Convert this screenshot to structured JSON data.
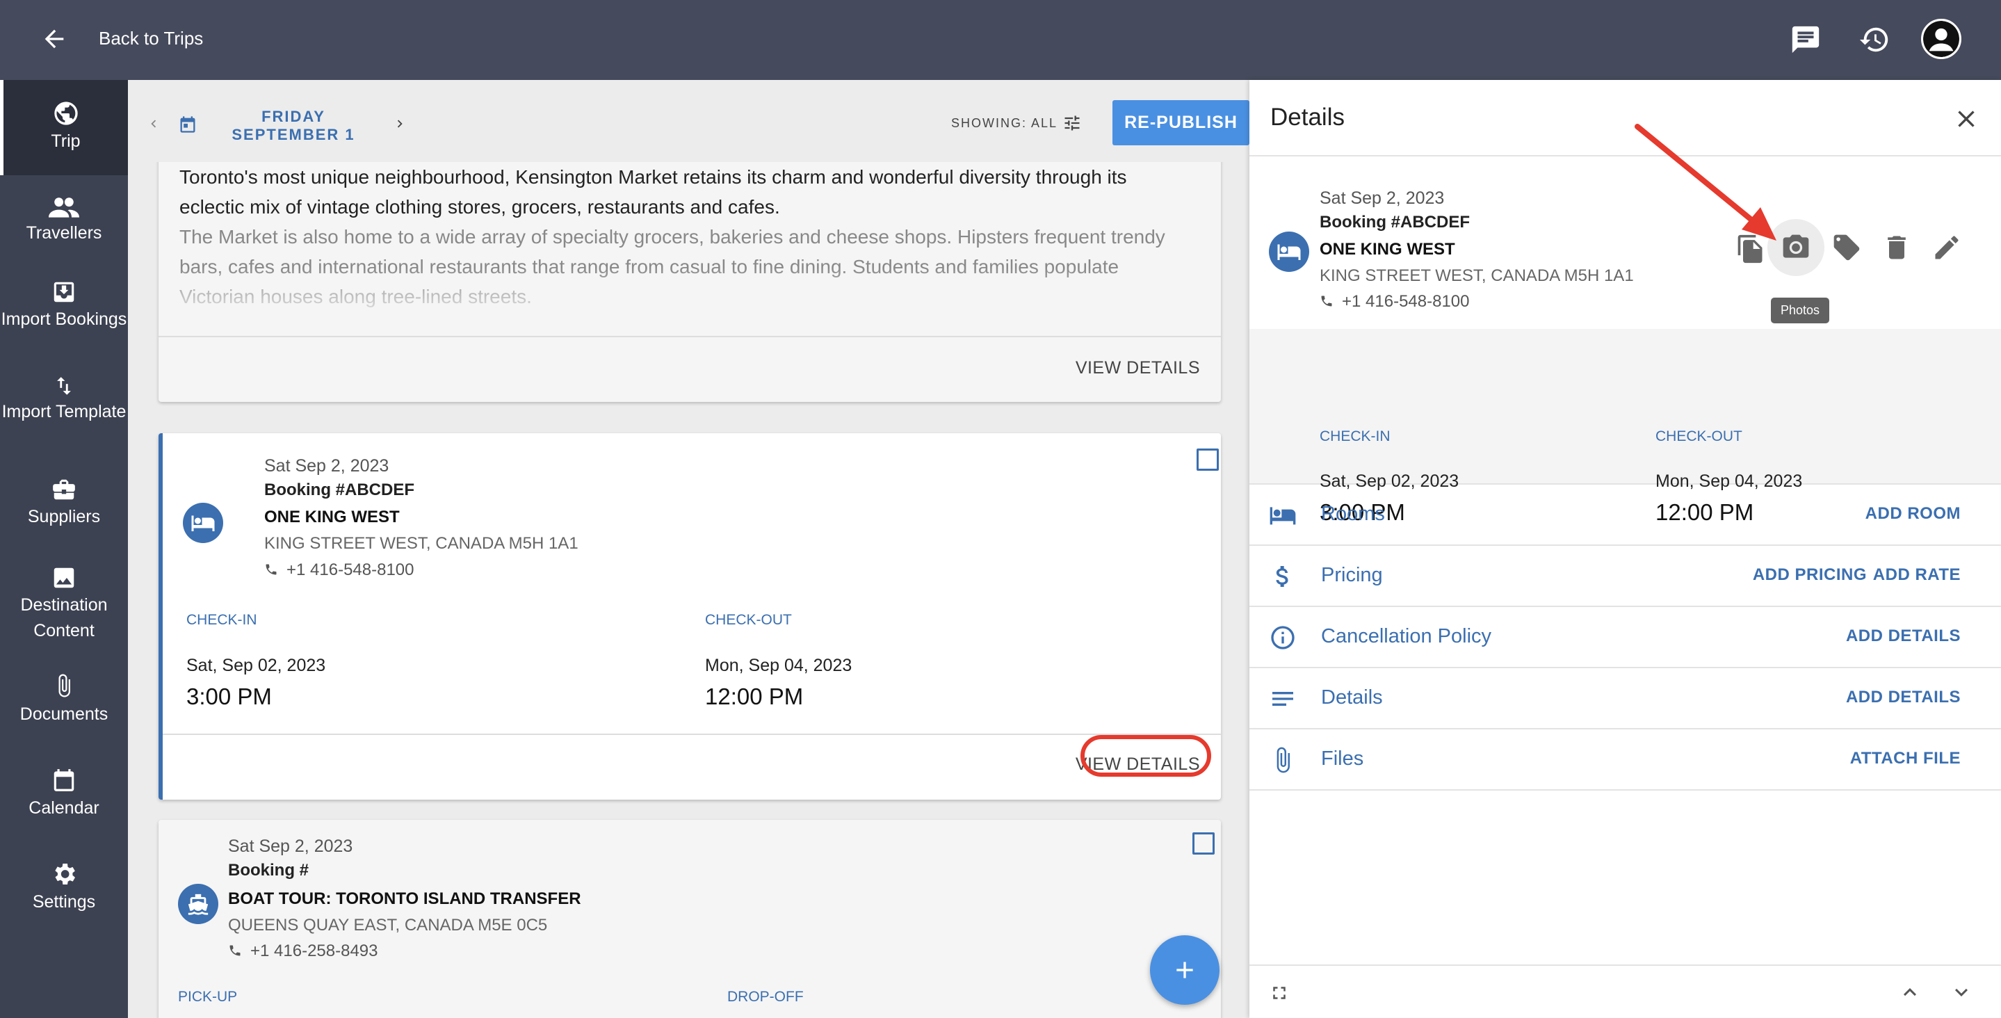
{
  "topbar": {
    "back_label": "Back to Trips"
  },
  "sidebar": {
    "items": [
      {
        "label": "Trip"
      },
      {
        "label": "Travellers"
      },
      {
        "label": "Import Bookings"
      },
      {
        "label": "Import Template"
      },
      {
        "label": "Suppliers"
      },
      {
        "label": "Destination Content"
      },
      {
        "label": "Documents"
      },
      {
        "label": "Calendar"
      },
      {
        "label": "Settings"
      }
    ]
  },
  "datebar": {
    "date_label": "FRIDAY SEPTEMBER 1",
    "showing_label": "SHOWING: ALL",
    "republish_label": "RE-PUBLISH"
  },
  "cards": {
    "destination": {
      "text_main": "Toronto's most unique neighbourhood, Kensington Market retains its charm and wonderful diversity through its eclectic mix of vintage clothing stores, grocers, restaurants and cafes.",
      "text_fade": "The Market is also home to a wide array of specialty grocers, bakeries and cheese shops. Hipsters frequent trendy bars, cafes and international restaurants that range from casual to fine dining. Students and families populate Victorian houses along tree-lined streets.",
      "view_label": "VIEW DETAILS"
    },
    "hotel": {
      "date": "Sat Sep 2, 2023",
      "booking": "Booking #ABCDEF",
      "name": "ONE KING WEST",
      "address": "KING STREET WEST, CANADA M5H 1A1",
      "phone": "+1 416-548-8100",
      "checkin_label": "CHECK-IN",
      "checkin_date": "Sat, Sep 02, 2023",
      "checkin_time": "3:00 PM",
      "checkout_label": "CHECK-OUT",
      "checkout_date": "Mon, Sep 04, 2023",
      "checkout_time": "12:00 PM",
      "view_label": "VIEW DETAILS"
    },
    "boat": {
      "date": "Sat Sep 2, 2023",
      "booking": "Booking #",
      "name": "BOAT TOUR: TORONTO ISLAND TRANSFER",
      "address": "QUEENS QUAY EAST, CANADA M5E 0C5",
      "phone": "+1 416-258-8493",
      "pickup_label": "PICK-UP",
      "dropoff_label": "DROP-OFF"
    }
  },
  "panel": {
    "title": "Details",
    "date": "Sat Sep 2, 2023",
    "booking": "Booking #ABCDEF",
    "name": "ONE KING WEST",
    "address": "KING STREET WEST, CANADA M5H 1A1",
    "phone": "+1 416-548-8100",
    "tooltip": "Photos",
    "checkin_label": "CHECK-IN",
    "checkin_date": "Sat, Sep 02, 2023",
    "checkin_time": "3:00 PM",
    "checkout_label": "CHECK-OUT",
    "checkout_date": "Mon, Sep 04, 2023",
    "checkout_time": "12:00 PM",
    "rows": {
      "rooms": {
        "label": "Rooms",
        "action": "ADD ROOM"
      },
      "pricing": {
        "label": "Pricing",
        "action": "ADD PRICING",
        "action2": "ADD RATE"
      },
      "cancellation": {
        "label": "Cancellation Policy",
        "action": "ADD DETAILS"
      },
      "details": {
        "label": "Details",
        "action": "ADD DETAILS"
      },
      "files": {
        "label": "Files",
        "action": "ATTACH FILE"
      }
    }
  },
  "colors": {
    "topbar": "#454a5c",
    "sidebar": "#3d4252",
    "accent": "#3b6fb0",
    "button": "#4a90e2",
    "annotation": "#e53a2d"
  }
}
